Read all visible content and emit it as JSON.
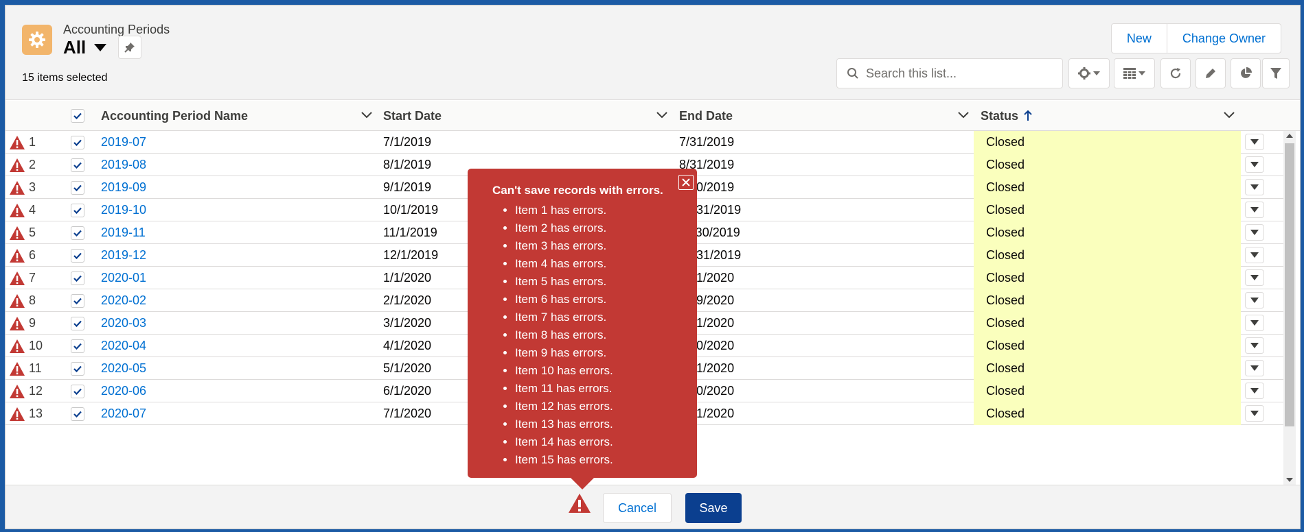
{
  "header": {
    "object_label": "Accounting Periods",
    "view_name": "All",
    "selected_info": "15 items selected",
    "buttons": [
      {
        "label": "New"
      },
      {
        "label": "Change Owner"
      }
    ],
    "search_placeholder": "Search this list..."
  },
  "columns": {
    "name": "Accounting Period Name",
    "start": "Start Date",
    "end": "End Date",
    "status": "Status"
  },
  "rows": [
    {
      "num": "1",
      "name": "2019-07",
      "start": "7/1/2019",
      "end": "7/31/2019",
      "status": "Closed"
    },
    {
      "num": "2",
      "name": "2019-08",
      "start": "8/1/2019",
      "end": "8/31/2019",
      "status": "Closed"
    },
    {
      "num": "3",
      "name": "2019-09",
      "start": "9/1/2019",
      "end": "9/30/2019",
      "status": "Closed"
    },
    {
      "num": "4",
      "name": "2019-10",
      "start": "10/1/2019",
      "end": "10/31/2019",
      "status": "Closed"
    },
    {
      "num": "5",
      "name": "2019-11",
      "start": "11/1/2019",
      "end": "11/30/2019",
      "status": "Closed"
    },
    {
      "num": "6",
      "name": "2019-12",
      "start": "12/1/2019",
      "end": "12/31/2019",
      "status": "Closed"
    },
    {
      "num": "7",
      "name": "2020-01",
      "start": "1/1/2020",
      "end": "1/31/2020",
      "status": "Closed"
    },
    {
      "num": "8",
      "name": "2020-02",
      "start": "2/1/2020",
      "end": "2/29/2020",
      "status": "Closed"
    },
    {
      "num": "9",
      "name": "2020-03",
      "start": "3/1/2020",
      "end": "3/31/2020",
      "status": "Closed"
    },
    {
      "num": "10",
      "name": "2020-04",
      "start": "4/1/2020",
      "end": "4/30/2020",
      "status": "Closed"
    },
    {
      "num": "11",
      "name": "2020-05",
      "start": "5/1/2020",
      "end": "5/31/2020",
      "status": "Closed"
    },
    {
      "num": "12",
      "name": "2020-06",
      "start": "6/1/2020",
      "end": "6/30/2020",
      "status": "Closed"
    },
    {
      "num": "13",
      "name": "2020-07",
      "start": "7/1/2020",
      "end": "7/31/2020",
      "status": "Closed"
    }
  ],
  "error_popover": {
    "title": "Can't save records with errors.",
    "items": [
      "Item 1 has errors.",
      "Item 2 has errors.",
      "Item 3 has errors.",
      "Item 4 has errors.",
      "Item 5 has errors.",
      "Item 6 has errors.",
      "Item 7 has errors.",
      "Item 8 has errors.",
      "Item 9 has errors.",
      "Item 10 has errors.",
      "Item 11 has errors.",
      "Item 12 has errors.",
      "Item 13 has errors.",
      "Item 14 has errors.",
      "Item 15 has errors."
    ]
  },
  "footer": {
    "cancel_label": "Cancel",
    "save_label": "Save"
  },
  "colors": {
    "brand": "#0070d2",
    "save_button": "#0b3f8f",
    "error": "#c23934",
    "status_cell_highlight": "#faffbd",
    "object_icon": "#f2b56b"
  },
  "icons": {
    "object": "gear-icon",
    "pin": "pin-icon",
    "search": "search-icon",
    "settings": "gear-icon",
    "display": "table-icon",
    "refresh": "refresh-icon",
    "edit": "pencil-icon",
    "charts": "pie-chart-icon",
    "filter": "filter-icon",
    "row_error": "warning-icon",
    "close": "close-icon"
  }
}
